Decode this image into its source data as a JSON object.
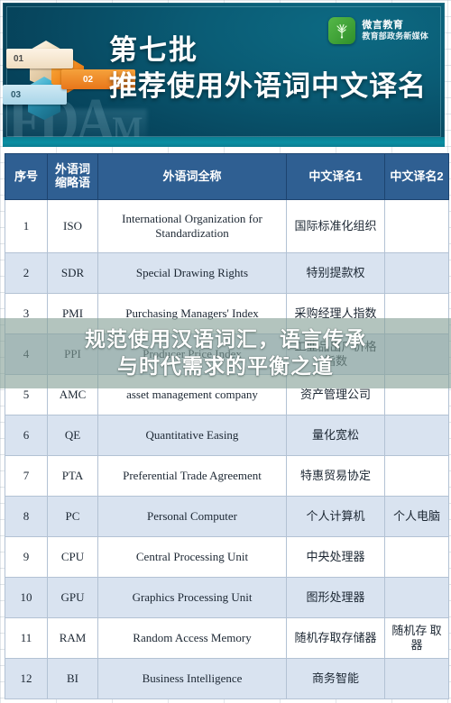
{
  "banner": {
    "headline_line1": "第七批",
    "headline_line2": "推荐使用外语词中文译名",
    "watermark_main": "FDA",
    "watermark_small": "M",
    "steps": [
      {
        "label": "01"
      },
      {
        "label": "02"
      },
      {
        "label": "03"
      }
    ],
    "logo": {
      "name_primary": "微言教育",
      "name_secondary": "教育部政务新媒体",
      "mark_icon": "green-sprout-logo-icon",
      "mark_color": "#3f9b34"
    },
    "colors": {
      "background_dark": "#053a52",
      "background_light": "#0d6a83",
      "accent_strip": "#0a8fa3"
    }
  },
  "caption": {
    "text": "规范使用汉语词汇，语言传承\n与时代需求的平衡之道",
    "band_color": "#84a096"
  },
  "table": {
    "headers": [
      "序号",
      "外语词\n缩略语",
      "外语词全称",
      "中文译名1",
      "中文译名2"
    ],
    "header_bg": "#2f5f92",
    "alt_row_bg": "#d9e3f0",
    "rows": [
      {
        "no": "1",
        "abbr": "ISO",
        "full": "International Organization for Standardization",
        "cn1": "国际标准化组织",
        "cn2": ""
      },
      {
        "no": "2",
        "abbr": "SDR",
        "full": "Special Drawing Rights",
        "cn1": "特别提款权",
        "cn2": ""
      },
      {
        "no": "3",
        "abbr": "PMI",
        "full": "Purchasing Managers' Index",
        "cn1": "采购经理人指数",
        "cn2": ""
      },
      {
        "no": "4",
        "abbr": "PPI",
        "full": "Producer Price Index",
        "cn1": "工业品出厂价格指数",
        "cn2": ""
      },
      {
        "no": "5",
        "abbr": "AMC",
        "full": "asset management company",
        "cn1": "资产管理公司",
        "cn2": ""
      },
      {
        "no": "6",
        "abbr": "QE",
        "full": "Quantitative Easing",
        "cn1": "量化宽松",
        "cn2": ""
      },
      {
        "no": "7",
        "abbr": "PTA",
        "full": "Preferential Trade Agreement",
        "cn1": "特惠贸易协定",
        "cn2": ""
      },
      {
        "no": "8",
        "abbr": "PC",
        "full": "Personal Computer",
        "cn1": "个人计算机",
        "cn2": "个人电脑"
      },
      {
        "no": "9",
        "abbr": "CPU",
        "full": "Central Processing Unit",
        "cn1": "中央处理器",
        "cn2": ""
      },
      {
        "no": "10",
        "abbr": "GPU",
        "full": "Graphics Processing Unit",
        "cn1": "图形处理器",
        "cn2": ""
      },
      {
        "no": "11",
        "abbr": "RAM",
        "full": "Random Access Memory",
        "cn1": "随机存取存储器",
        "cn2": "随机存 取器"
      },
      {
        "no": "12",
        "abbr": "BI",
        "full": "Business Intelligence",
        "cn1": "商务智能",
        "cn2": ""
      }
    ]
  }
}
